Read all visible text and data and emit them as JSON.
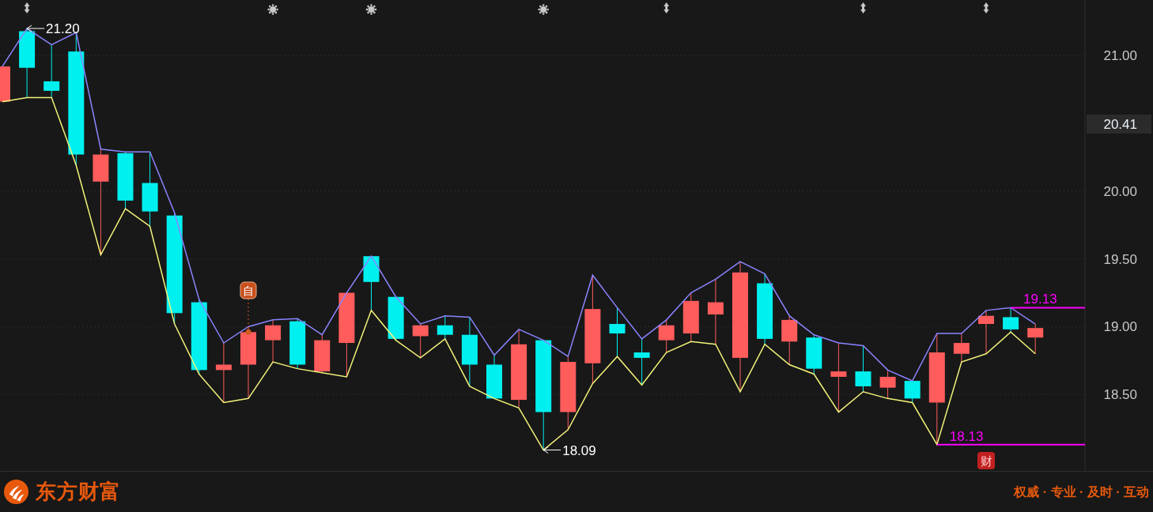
{
  "chart": {
    "chart_data": {
      "type": "line",
      "grid": true,
      "ylim": [
        17.93,
        21.41
      ],
      "yticks": [
        {
          "value": 21.0,
          "label": "21.00"
        },
        {
          "value": 20.0,
          "label": "20.00"
        },
        {
          "value": 19.5,
          "label": "19.50"
        },
        {
          "value": 19.0,
          "label": "19.00"
        },
        {
          "value": 18.5,
          "label": "18.50"
        }
      ],
      "series": [
        {
          "color": "#8a84ff",
          "values": [
            20.92,
            21.2,
            21.08,
            21.17,
            20.31,
            20.29,
            20.29,
            19.84,
            19.2,
            18.88,
            19.0,
            19.05,
            19.06,
            18.94,
            19.25,
            19.52,
            19.22,
            19.02,
            19.08,
            19.07,
            18.79,
            18.98,
            18.9,
            18.78,
            19.38,
            19.14,
            18.91,
            19.05,
            19.25,
            19.35,
            19.48,
            19.39,
            19.08,
            18.94,
            18.88,
            18.86,
            18.68,
            18.6,
            18.95,
            18.95,
            19.12,
            19.14,
            19.02
          ]
        },
        {
          "color": "#f2f27a",
          "values": [
            20.66,
            20.69,
            20.69,
            20.19,
            19.53,
            19.87,
            19.74,
            19.02,
            18.65,
            18.44,
            18.47,
            18.74,
            18.69,
            18.66,
            18.63,
            19.12,
            18.9,
            18.77,
            18.91,
            18.56,
            18.47,
            18.4,
            18.09,
            18.24,
            18.58,
            18.78,
            18.57,
            18.81,
            18.89,
            18.87,
            18.52,
            18.87,
            18.72,
            18.65,
            18.37,
            18.52,
            18.47,
            18.44,
            18.13,
            18.74,
            18.8,
            18.96,
            18.8
          ]
        }
      ],
      "annotations": [
        "21.20",
        "18.09"
      ],
      "ref_lines": [
        {
          "label": "19.13",
          "color": "#ff00ff"
        },
        {
          "label": "18.13",
          "color": "#ff00ff"
        }
      ]
    },
    "current_price_label": "20.41",
    "top_markers": [
      {
        "kind": "split"
      },
      {
        "kind": "star"
      },
      {
        "kind": "star"
      },
      {
        "kind": "star"
      },
      {
        "kind": "split"
      },
      {
        "kind": "split"
      },
      {
        "kind": "split"
      }
    ],
    "badges": [
      {
        "kind": "note",
        "label": "自"
      },
      {
        "kind": "finance",
        "label": "财"
      }
    ]
  },
  "footer": {
    "brand": "东方财富",
    "slogan": "权威 · 专业 · 及时 · 互动"
  }
}
